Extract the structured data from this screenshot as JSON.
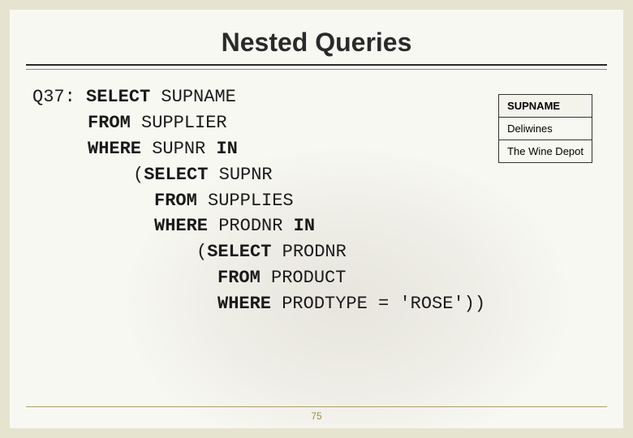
{
  "title": "Nested Queries",
  "query": {
    "line1_prefix": "Q37: ",
    "line1_kw": "SELECT",
    "line1_rest": " SUPNAME",
    "line2_kw": "FROM",
    "line2_rest": " SUPPLIER",
    "line3_kw1": "WHERE",
    "line3_mid": " SUPNR ",
    "line3_kw2": "IN",
    "line4_open": "(",
    "line4_kw": "SELECT",
    "line4_rest": " SUPNR",
    "line5_kw": "FROM",
    "line5_rest": " SUPPLIES",
    "line6_kw1": "WHERE",
    "line6_mid": " PRODNR ",
    "line6_kw2": "IN",
    "line7_open": "(",
    "line7_kw": "SELECT",
    "line7_rest": " PRODNR",
    "line8_kw": "FROM",
    "line8_rest": " PRODUCT",
    "line9_kw": "WHERE",
    "line9_rest": " PRODTYPE = 'ROSE'))"
  },
  "result": {
    "header": "SUPNAME",
    "rows": [
      "Deliwines",
      "The Wine Depot"
    ]
  },
  "page_number": "75"
}
